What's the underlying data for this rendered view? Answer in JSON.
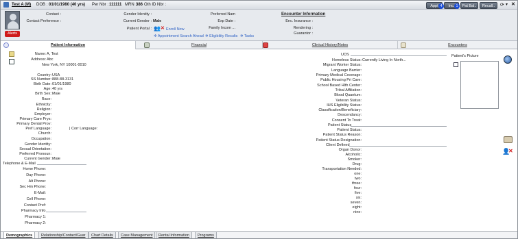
{
  "header": {
    "patient_name": "Test A",
    "sex": "(M)",
    "dob_label": "DOB :",
    "dob": "01/01/1980 (40 yrs)",
    "per_nbr_label": "Per Nbr :",
    "per_nbr": "111111",
    "mrn_label": "MRN :",
    "mrn": "386",
    "oth_id_label": "Oth ID Nbr :",
    "contact_label": "Contact :",
    "contact_pref_label": "Contact Preference :",
    "gender_identity_label": "Gender Identity :",
    "current_gender_label": "Current Gender :",
    "current_gender": "Male",
    "patient_portal_label": "Patient Portal :",
    "enroll_now": "Enroll Now",
    "preferred_name_label": "Preferred Nam",
    "exp_date_label": "Exp Date :",
    "family_income_label": "Family Incom ...",
    "encounter_info_title": "Encounter Information",
    "enc_insurance_label": "Enc. Insurance :",
    "rendering_label": "Rendering :",
    "guarantor_label": "Guarantor :",
    "links": [
      "Appointment Search Ahead",
      "Eligibility Results",
      "Tasks"
    ],
    "alerts": "Alerts",
    "buttons": [
      {
        "label": "Appt",
        "badge": "4"
      },
      {
        "label": "Inc.",
        "badge": "1"
      },
      {
        "label": "Pat Bal..",
        "badge": ""
      },
      {
        "label": "Recall..",
        "badge": ""
      }
    ]
  },
  "tabs": [
    {
      "label": "Patient Information",
      "active": true
    },
    {
      "label": "Financial",
      "active": false
    },
    {
      "label": "Clinical History/Notes",
      "active": false
    },
    {
      "label": "Encounters",
      "active": false
    }
  ],
  "left": {
    "name_label": "Name:",
    "name_value": "A, Test",
    "address_label": "Address:",
    "address_line1": "Abc",
    "address_line2": "New York, NY 10001-0010",
    "country_label": "Country:",
    "country_value": "USA",
    "ssn_label": "SS Number:",
    "ssn_value": "888-88-3131",
    "birth_date_label": "Birth Date:",
    "birth_date_value": "01/01/1980",
    "age_label": "Age:",
    "age_value": "40 yrs",
    "birth_sex_label": "Birth Sex:",
    "birth_sex_value": "Male",
    "race_label": "Race:",
    "ethnicity_label": "Ethnicity:",
    "religion_label": "Religion:",
    "employer_label": "Employer:",
    "primary_care_label": "Primary Care Prys:",
    "primary_dental_label": "Primary Dental Prov:",
    "pref_language_label": "Pref Language:",
    "corr_language_label": "Corr Language:",
    "church_label": "Church:",
    "occupation_label": "Occupation:",
    "gender_identity_label": "Gender Identity:",
    "sexual_orientation_label": "Sexual Orientation:",
    "preferred_pronoun_label": "Preferred Pronoun:",
    "current_gender_label": "Current Gender:",
    "current_gender_value": "Male",
    "telephone_section": "Telephone & E-Mail",
    "home_phone_label": "Home Phone:",
    "day_phone_label": "Day Phone:",
    "alt_phone_label": "Alt Phone:",
    "sec_hm_phone_label": "Sec Hm Phone:",
    "email_label": "E-Mail:",
    "cell_phone_label": "Cell Phone:",
    "contact_pref_label": "Contact Pref:",
    "pharmacy_section": "Pharmacy Info",
    "pharmacy1_label": "Pharmacy 1:",
    "pharmacy2_label": "Pharmacy 2:"
  },
  "right": {
    "uds_section": "UDS",
    "homeless_label": "Homeless Status:",
    "homeless_value": "Currently Living In North...",
    "migrant_label": "Migrant Worker Status:",
    "language_barrier_label": "Language Barrier:",
    "primary_medical_label": "Primary Medical Coverage:",
    "public_housing_label": "Public Housing Pri Care:",
    "school_based_label": "School Based Hlth Center:",
    "tribal_label": "Tribal Affiliation:",
    "blood_quantum_label": "Blood Quantum:",
    "veteran_label": "Veteran Status:",
    "ihs_label": "IHS Eligibility Status:",
    "classification_label": "Classification/Beneficiary:",
    "descendancy_label": "Descendancy:",
    "consent_label": "Consent To Treat:",
    "patient_status_section": "Patient Status",
    "patient_status_label": "Patient Status:",
    "patient_status_reason_label": "Patient Status Reason:",
    "patient_status_designation_label": "Patient Status Designation:",
    "client_defined_section": "Client Defined",
    "organ_donor_label": "Organ Donor:",
    "alcoholic_label": "Alcoholic:",
    "smoker_label": "Smoker:",
    "drug_label": "Drug:",
    "transportation_label": "Transportation Needed:",
    "one_label": "one:",
    "two_label": "two:",
    "three_label": "three:",
    "four_label": "four:",
    "five_label": "five:",
    "six_label": "six:",
    "seven_label": "seven:",
    "eight_label": "eight:",
    "nine_label": "nine:",
    "patient_picture_label": "Patient's Picture"
  },
  "bottom_tabs": [
    {
      "label": "Demographics",
      "active": true
    },
    {
      "label": "Relationship/Contact/Guar",
      "active": false
    },
    {
      "label": "Chart Details",
      "active": false
    },
    {
      "label": "Case Management",
      "active": false
    },
    {
      "label": "Rental Information",
      "active": false
    },
    {
      "label": "Programs",
      "active": false
    }
  ]
}
